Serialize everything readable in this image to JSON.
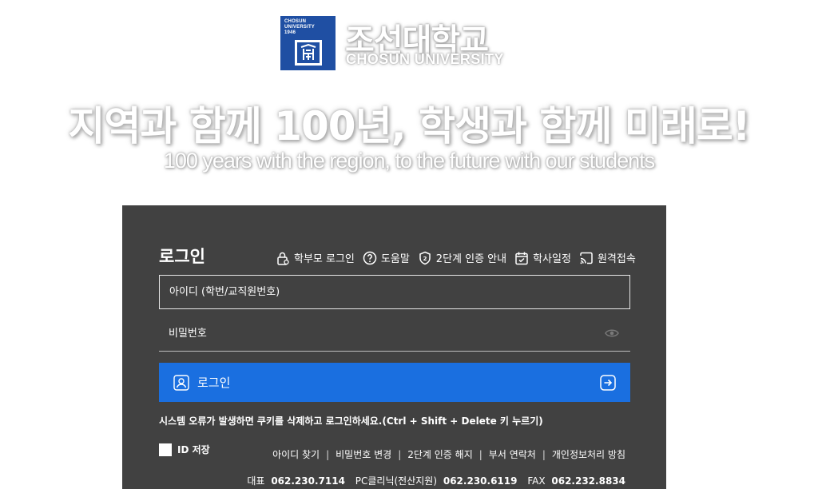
{
  "header": {
    "logo_small_line1": "CHOSUN",
    "logo_small_line2": "UNIVERSITY",
    "logo_small_line3": "1946",
    "name_ko": "조선대학교",
    "name_en": "CHOSUN UNIVERSITY",
    "slogan_ko": "지역과 함께 100년, 학생과 함께 미래로!",
    "slogan_en": "100 years with the region, to the future with our students"
  },
  "login": {
    "title": "로그인",
    "quick_links": [
      {
        "label": "학부모 로그인",
        "icon": "lock-icon"
      },
      {
        "label": "도움말",
        "icon": "help-icon"
      },
      {
        "label": "2단계 인증 안내",
        "icon": "shield-icon"
      },
      {
        "label": "학사일정",
        "icon": "calendar-icon"
      },
      {
        "label": "원격접속",
        "icon": "cast-icon"
      }
    ],
    "id_placeholder": "아이디 (학번/교직원번호)",
    "pw_placeholder": "비밀번호",
    "button_label": "로그인",
    "notice": "시스템 오류가 발생하면 쿠키를 삭제하고 로그인하세요.(Ctrl + Shift + Delete 키 누르기)",
    "save_id_label": "ID 저장",
    "bottom_links": [
      "아이디 찾기",
      "비밀번호 변경",
      "2단계 인증 해지",
      "부서 연락처",
      "개인정보처리 방침"
    ],
    "contact": {
      "main_label": "대표",
      "main_number": "062.230.7114",
      "pc_label": "PC클리닉(전산지원)",
      "pc_number": "062.230.6119",
      "fax_label": "FAX",
      "fax_number": "062.232.8834"
    }
  },
  "colors": {
    "logo_blue": "#1f4fa3",
    "panel_bg": "#414141",
    "button_blue": "#1a6fe0"
  }
}
